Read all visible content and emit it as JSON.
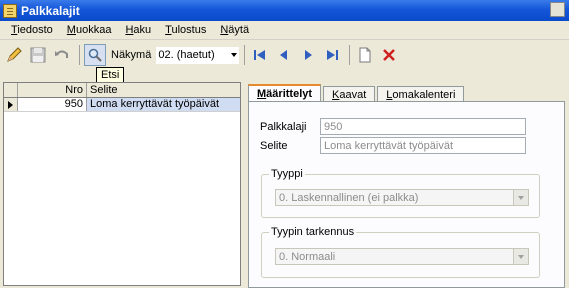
{
  "window": {
    "title": "Palkkalajit"
  },
  "menu": {
    "items": [
      {
        "mnemonic": "T",
        "rest": "iedosto"
      },
      {
        "mnemonic": "M",
        "rest": "uokkaa"
      },
      {
        "mnemonic": "H",
        "rest": "aku"
      },
      {
        "mnemonic": "T",
        "rest": "ulostus",
        "prefix": ""
      },
      {
        "mnemonic": "N",
        "rest": "äytä"
      }
    ]
  },
  "toolbar": {
    "view_label": "Näkymä",
    "view_value": "02. (haetut)",
    "icons": [
      "edit-icon",
      "save-icon",
      "undo-icon",
      "search-icon",
      "first-icon",
      "prev-icon",
      "next-icon",
      "last-icon",
      "copy-icon",
      "delete-icon"
    ]
  },
  "tooltip": "Etsi",
  "grid": {
    "columns": [
      "Nro",
      "Selite"
    ],
    "rows": [
      {
        "nro": "950",
        "selite": "Loma kerryttävät työpäivät"
      }
    ]
  },
  "tabs": [
    {
      "mnemonic": "M",
      "rest": "äärittelyt"
    },
    {
      "mnemonic": "K",
      "rest": "aavat"
    },
    {
      "mnemonic": "L",
      "rest": "omakalenteri"
    }
  ],
  "form": {
    "palkkalaji_label": "Palkkalaji",
    "palkkalaji_value": "950",
    "selite_label": "Selite",
    "selite_value": "Loma kerryttävät työpäivät",
    "tyyppi_title": "Tyyppi",
    "tyyppi_value": "0. Laskennallinen (ei palkka)",
    "tarkennus_title": "Tyypin tarkennus",
    "tarkennus_value": "0. Normaali"
  },
  "colors": {
    "titlebar": "#0a4bcc",
    "selection": "#cfdcf1",
    "tab_highlight": "#e68b2c"
  }
}
